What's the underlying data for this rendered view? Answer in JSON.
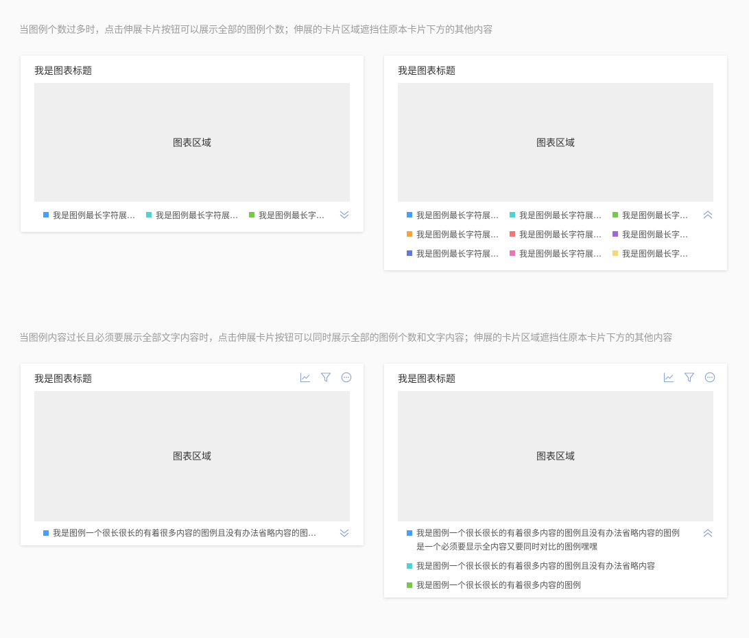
{
  "notes": {
    "top": "当图例个数过多时，点击伸展卡片按钮可以展示全部的图例个数；伸展的卡片区域遮挡住原本卡片下方的其他内容",
    "bottom": "当图例内容过长且必须要展示全部文字内容时，点击伸展卡片按钮可以同时展示全部的图例个数和文字内容；伸展的卡片区域遮挡住原本卡片下方的其他内容"
  },
  "chart_title": "我是图表标题",
  "chart_area_label": "图表区域",
  "legend_short": "我是图例最长字符展示宽度",
  "legend_long_full": "我是图例一个很长很长的有着很多内容的图例且没有办法省略内容的图例是一个必须要显示全内容又要同时对比的图例嘿嘿",
  "legend_long_2": "我是图例一个很长很长的有着很多内容的图例且没有办法省略内容",
  "legend_long_3": "我是图例一个很长很长的有着很多内容的图例",
  "icons": {
    "expand": "chevron-double-down-icon",
    "collapse": "chevron-double-up-icon",
    "line_chart": "line-chart-icon",
    "filter": "filter-icon",
    "more": "more-icon"
  },
  "colors": {
    "blue": "#4a9ff5",
    "cyan": "#4fd2d2",
    "green": "#7ac74f",
    "orange": "#f5a444",
    "red": "#f0767a",
    "purple": "#9b6ad8",
    "indigo": "#6479d8",
    "pink": "#ea76b8",
    "yellow": "#f8d77a",
    "icon": "#8aa4d6"
  }
}
